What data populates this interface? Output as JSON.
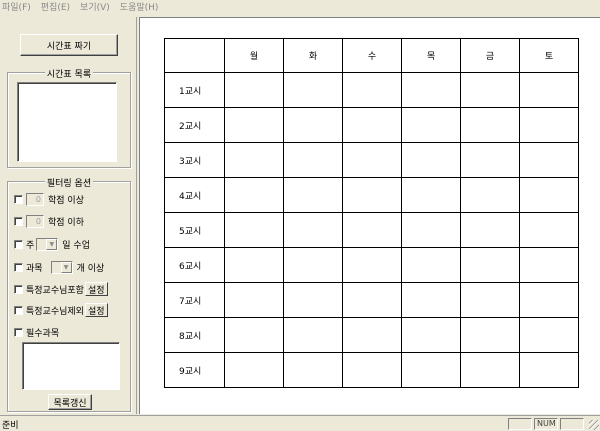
{
  "menu": [
    "파일(F)",
    "편집(E)",
    "보기(V)",
    "도움말(H)"
  ],
  "left": {
    "make_button": "시간표 짜기",
    "list_group_title": "시간표 목록",
    "filter_group_title": "필터링 옵션",
    "credits_min_value": "0",
    "credits_min_label": "학점 이상",
    "credits_max_value": "0",
    "credits_max_label": "학점 이하",
    "week_prefix": "주",
    "week_suffix": "일 수업",
    "subject_prefix": "과목",
    "subject_suffix": "개 이상",
    "prof_include_label": "특정교수님포함",
    "prof_exclude_label": "특정교수님제외",
    "set_button": "설정",
    "required_label": "필수과목",
    "refresh_button": "목록갱신"
  },
  "timetable": {
    "days": [
      "월",
      "화",
      "수",
      "목",
      "금",
      "토"
    ],
    "periods": [
      "1교시",
      "2교시",
      "3교시",
      "4교시",
      "5교시",
      "6교시",
      "7교시",
      "8교시",
      "9교시"
    ]
  },
  "status": {
    "text": "준비",
    "num": "NUM"
  }
}
